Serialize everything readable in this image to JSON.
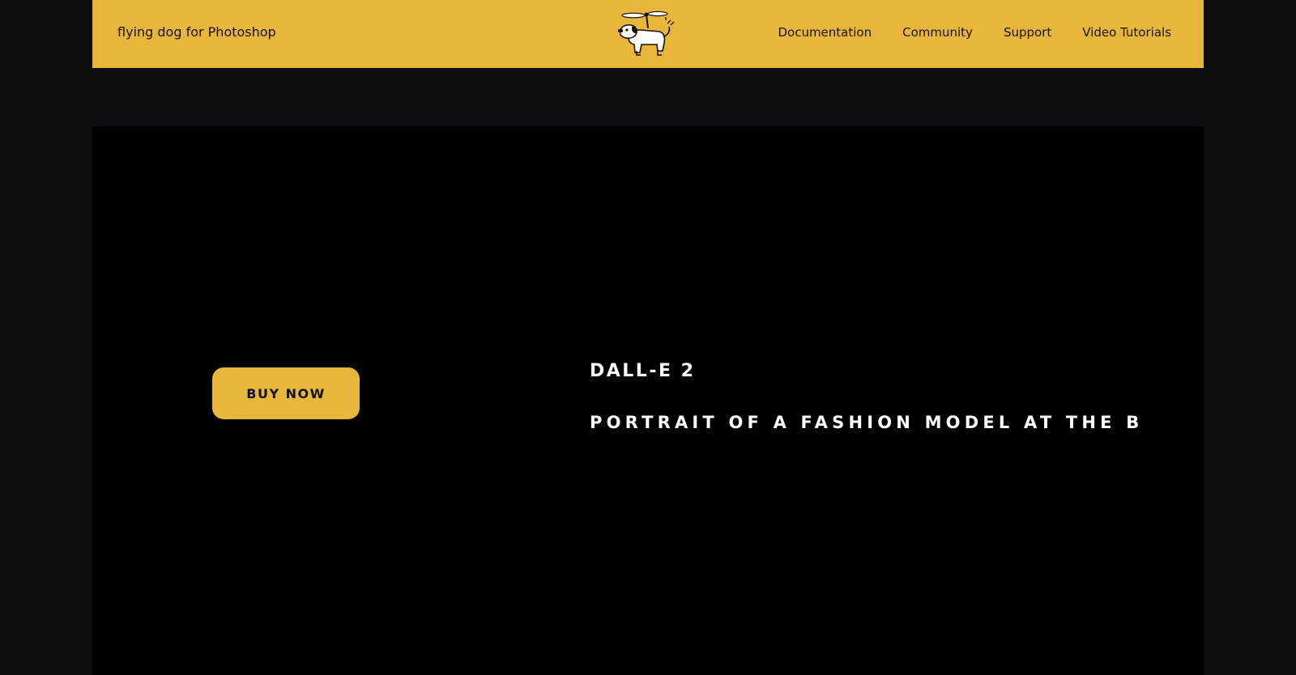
{
  "header": {
    "brand": "flying dog for Photoshop",
    "logo_icon": "flying-dog-logo-icon",
    "nav": [
      {
        "label": "Documentation"
      },
      {
        "label": "Community"
      },
      {
        "label": "Support"
      },
      {
        "label": "Video Tutorials"
      }
    ]
  },
  "hero": {
    "button_label": "BUY NOW",
    "title": "DALL-E 2",
    "caption": "PORTRAIT OF A FASHION MODEL AT THE B"
  },
  "colors": {
    "accent": "#e7b63b",
    "page_background": "#0d0d12",
    "hero_background": "#000000",
    "hero_text": "#ffffff"
  }
}
